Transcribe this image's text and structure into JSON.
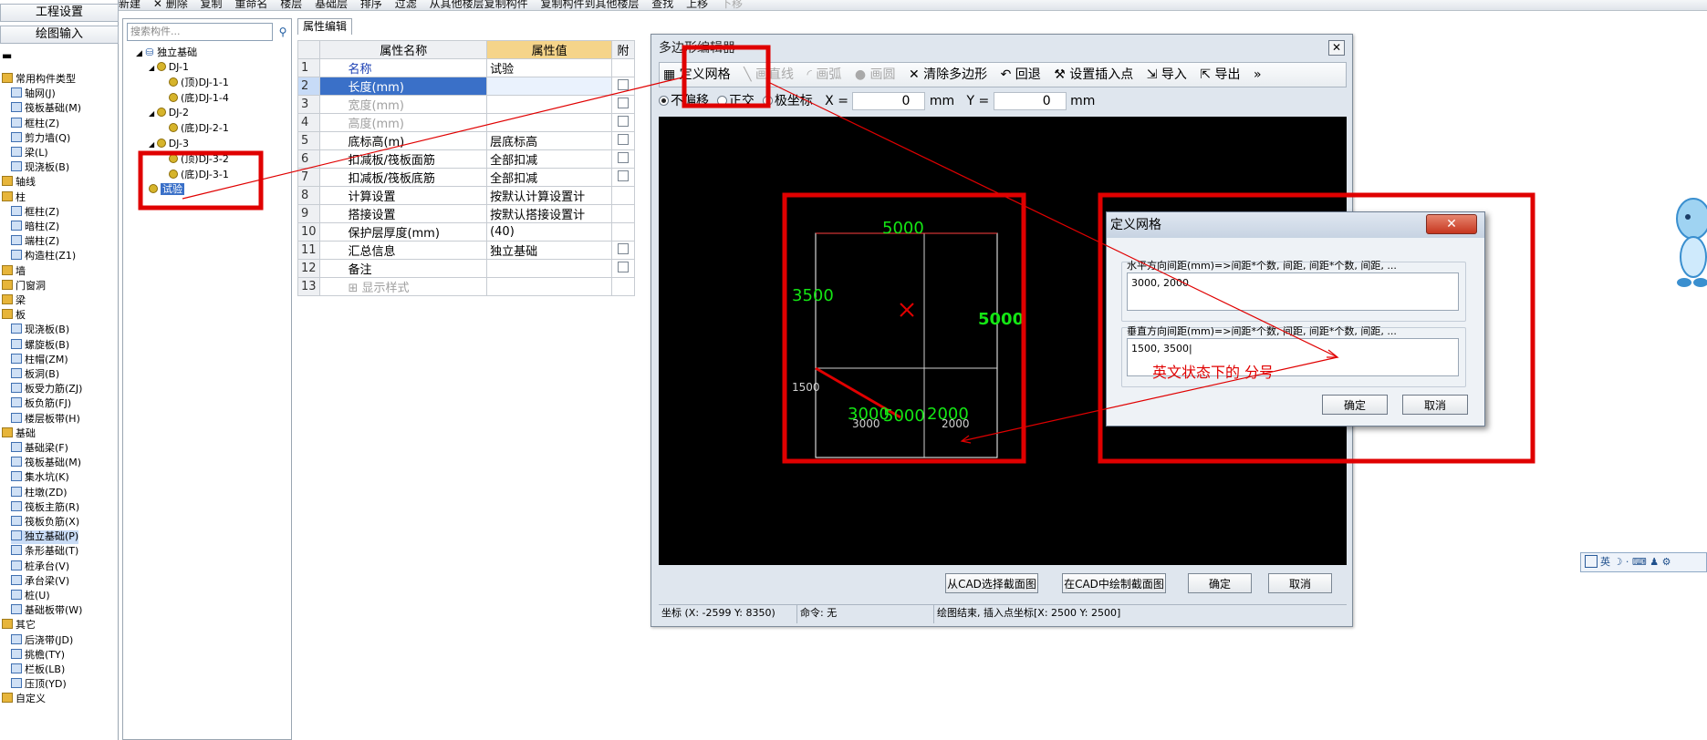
{
  "toolbar": {
    "items": [
      "新建",
      "✕ 删除",
      "复制",
      "重命名",
      "楼层",
      "基础层",
      "排序",
      "过滤",
      "从其他楼层复制构件",
      "复制构件到其他楼层",
      "查找",
      "上移",
      "下移"
    ]
  },
  "leftnav": {
    "project_settings": "工程设置",
    "drawing_input": "绘图输入",
    "items": [
      {
        "label": "常用构件类型",
        "type": "folder"
      },
      {
        "label": "轴网(J)",
        "type": "comp"
      },
      {
        "label": "筏板基础(M)",
        "type": "comp"
      },
      {
        "label": "框柱(Z)",
        "type": "comp"
      },
      {
        "label": "剪力墙(Q)",
        "type": "comp"
      },
      {
        "label": "梁(L)",
        "type": "comp"
      },
      {
        "label": "现浇板(B)",
        "type": "comp"
      },
      {
        "label": "轴线",
        "type": "folder"
      },
      {
        "label": "柱",
        "type": "folder"
      },
      {
        "label": "框柱(Z)",
        "type": "comp"
      },
      {
        "label": "暗柱(Z)",
        "type": "comp"
      },
      {
        "label": "端柱(Z)",
        "type": "comp"
      },
      {
        "label": "构造柱(Z1)",
        "type": "comp"
      },
      {
        "label": "墙",
        "type": "folder"
      },
      {
        "label": "门窗洞",
        "type": "folder"
      },
      {
        "label": "梁",
        "type": "folder"
      },
      {
        "label": "板",
        "type": "folder"
      },
      {
        "label": "现浇板(B)",
        "type": "comp"
      },
      {
        "label": "螺旋板(B)",
        "type": "comp"
      },
      {
        "label": "柱帽(ZM)",
        "type": "comp"
      },
      {
        "label": "板洞(B)",
        "type": "comp"
      },
      {
        "label": "板受力筋(ZJ)",
        "type": "comp"
      },
      {
        "label": "板负筋(FJ)",
        "type": "comp"
      },
      {
        "label": "楼层板带(H)",
        "type": "comp"
      },
      {
        "label": "基础",
        "type": "folder"
      },
      {
        "label": "基础梁(F)",
        "type": "comp"
      },
      {
        "label": "筏板基础(M)",
        "type": "comp"
      },
      {
        "label": "集水坑(K)",
        "type": "comp"
      },
      {
        "label": "柱墩(ZD)",
        "type": "comp"
      },
      {
        "label": "筏板主筋(R)",
        "type": "comp"
      },
      {
        "label": "筏板负筋(X)",
        "type": "comp"
      },
      {
        "label": "独立基础(P)",
        "type": "comp",
        "selected": true
      },
      {
        "label": "条形基础(T)",
        "type": "comp"
      },
      {
        "label": "桩承台(V)",
        "type": "comp"
      },
      {
        "label": "承台梁(V)",
        "type": "comp"
      },
      {
        "label": "桩(U)",
        "type": "comp"
      },
      {
        "label": "基础板带(W)",
        "type": "comp"
      },
      {
        "label": "其它",
        "type": "folder"
      },
      {
        "label": "后浇带(JD)",
        "type": "comp"
      },
      {
        "label": "挑檐(TY)",
        "type": "comp"
      },
      {
        "label": "栏板(LB)",
        "type": "comp"
      },
      {
        "label": "压顶(YD)",
        "type": "comp"
      },
      {
        "label": "自定义",
        "type": "folder"
      }
    ]
  },
  "tree": {
    "search_placeholder": "搜索构件...",
    "root": "独立基础",
    "nodes": [
      {
        "label": "DJ-1",
        "level": 1
      },
      {
        "label": "(顶)DJ-1-1",
        "level": 2
      },
      {
        "label": "(底)DJ-1-4",
        "level": 2
      },
      {
        "label": "DJ-2",
        "level": 1
      },
      {
        "label": "(底)DJ-2-1",
        "level": 2
      },
      {
        "label": "DJ-3",
        "level": 1
      },
      {
        "label": "(顶)DJ-3-2",
        "level": 2
      },
      {
        "label": "(底)DJ-3-1",
        "level": 2
      },
      {
        "label": "试验",
        "level": 1,
        "selected": true
      }
    ]
  },
  "props": {
    "tab": "属性编辑",
    "headers": {
      "name": "属性名称",
      "value": "属性值",
      "attach": "附"
    },
    "rows": [
      {
        "num": "1",
        "name": "名称",
        "value": "试验",
        "style": "blue",
        "check": false
      },
      {
        "num": "2",
        "name": "长度(mm)",
        "value": "",
        "style": "selected",
        "check": true
      },
      {
        "num": "3",
        "name": "宽度(mm)",
        "value": "",
        "style": "gray",
        "check": true
      },
      {
        "num": "4",
        "name": "高度(mm)",
        "value": "",
        "style": "gray",
        "check": true
      },
      {
        "num": "5",
        "name": "底标高(m)",
        "value": "层底标高",
        "style": "",
        "check": true
      },
      {
        "num": "6",
        "name": "扣减板/筏板面筋",
        "value": "全部扣减",
        "style": "",
        "check": true
      },
      {
        "num": "7",
        "name": "扣减板/筏板底筋",
        "value": "全部扣减",
        "style": "",
        "check": true
      },
      {
        "num": "8",
        "name": "计算设置",
        "value": "按默认计算设置计",
        "style": "",
        "check": false
      },
      {
        "num": "9",
        "name": "搭接设置",
        "value": "按默认搭接设置计",
        "style": "",
        "check": false
      },
      {
        "num": "10",
        "name": "保护层厚度(mm)",
        "value": "(40)",
        "style": "",
        "check": false
      },
      {
        "num": "11",
        "name": "汇总信息",
        "value": "独立基础",
        "style": "",
        "check": true
      },
      {
        "num": "12",
        "name": "备注",
        "value": "",
        "style": "",
        "check": true
      },
      {
        "num": "13",
        "name": "⊞ 显示样式",
        "value": "",
        "style": "gray",
        "check": false
      }
    ]
  },
  "polyeditor": {
    "title": "多边形编辑器",
    "close": "✕",
    "tools": [
      {
        "label": "▦ 定义网格",
        "enabled": true
      },
      {
        "label": "╲ 画直线",
        "enabled": false
      },
      {
        "label": "◜ 画弧",
        "enabled": false
      },
      {
        "label": "● 画圆",
        "enabled": false
      },
      {
        "label": "✕ 清除多边形",
        "enabled": true
      },
      {
        "label": "↶ 回退",
        "enabled": true
      },
      {
        "label": "⚒ 设置插入点",
        "enabled": true
      },
      {
        "label": "⇲ 导入",
        "enabled": true
      },
      {
        "label": "⇱ 导出",
        "enabled": true
      },
      {
        "label": "»",
        "enabled": true
      }
    ],
    "modes": [
      "不偏移",
      "正交",
      "极坐标"
    ],
    "x_label": "X =",
    "x_value": "0",
    "y_label": "Y =",
    "y_value": "0",
    "unit": "mm",
    "grid_labels": {
      "top": "5000",
      "left": "3500",
      "right": "5000",
      "bottom_a": "3000",
      "bottom_b": "5000",
      "bottom_c": "2000",
      "left_small": "1500",
      "bottom_small_a": "3000",
      "bottom_small_b": "2000"
    },
    "btn_cad_select": "从CAD选择截面图",
    "btn_cad_draw": "在CAD中绘制截面图",
    "btn_ok": "确定",
    "btn_cancel": "取消",
    "status_coord": "坐标 (X: -2599 Y: 8350)",
    "status_cmd": "命令: 无",
    "status_msg": "绘图结束, 插入点坐标[X: 2500 Y: 2500]"
  },
  "griddlg": {
    "title": "定义网格",
    "close": "✕",
    "h_label": "水平方向间距(mm)=>间距*个数, 间距, 间距*个数, 间距, ...",
    "h_value": "3000, 2000",
    "v_label": "垂直方向间距(mm)=>间距*个数, 间距, 间距*个数, 间距, ...",
    "v_value": "1500, 3500|",
    "annotation": "英文状态下的 分号",
    "ok": "确定",
    "cancel": "取消"
  },
  "imebar": {
    "label": "英 ☽ · ⌨ ♟ ⚙"
  },
  "colors": {
    "annotation_red": "#e00000",
    "grid_green": "#14e614",
    "selected_blue": "#3a70c8"
  }
}
